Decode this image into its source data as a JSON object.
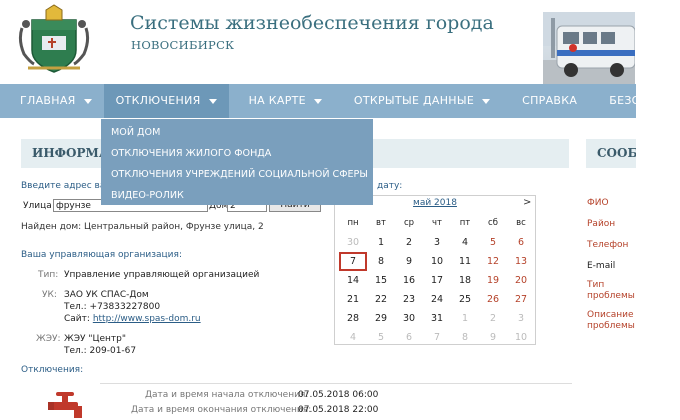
{
  "header": {
    "title": "Системы жизнеобеспечения города",
    "subtitle": "НОВОСИБИРСК"
  },
  "nav": {
    "items": [
      {
        "label": "ГЛАВНАЯ",
        "has_dropdown": true
      },
      {
        "label": "ОТКЛЮЧЕНИЯ",
        "has_dropdown": true,
        "active": true
      },
      {
        "label": "НА КАРТЕ",
        "has_dropdown": true
      },
      {
        "label": "ОТКРЫТЫЕ ДАННЫЕ",
        "has_dropdown": true
      },
      {
        "label": "СПРАВКА",
        "has_dropdown": false
      },
      {
        "label": "БЕЗОПАСНОС",
        "has_dropdown": false
      }
    ],
    "dropdown": [
      "МОЙ ДОМ",
      "ОТКЛЮЧЕНИЯ ЖИЛОГО ФОНДА",
      "ОТКЛЮЧЕНИЯ УЧРЕЖДЕНИЙ СОЦИАЛЬНОЙ СФЕРЫ",
      "ВИДЕО-РОЛИК"
    ]
  },
  "main": {
    "section_title": "ИНФОРМА",
    "address_prompt": "Введите адрес ва",
    "date_prompt": "дату:",
    "street_label": "Улица",
    "street_value": "фрунзе",
    "house_label": "Дом",
    "house_value": "2",
    "search_button": "Найти",
    "found_house": "Найден дом: Центральный район, Фрунзе улица, 2",
    "mgmt_heading": "Ваша управляющая организация:",
    "type_label": "Тип:",
    "type_value": "Управление управляющей организацией",
    "uk_label": "УК:",
    "uk_name": "ЗАО УК СПАС-Дом",
    "uk_phone": "Тел.: +73833227800",
    "uk_site_label": "Сайт:",
    "uk_site": "http://www.spas-dom.ru",
    "zheu_label": "ЖЭУ:",
    "zheu_name": "ЖЭУ \"Центр\"",
    "zheu_phone": "Тел.: 209-01-67",
    "outages_heading": "Отключения:",
    "start_label": "Дата и время начала отключения:",
    "start_value": "07.05.2018  06:00",
    "end_label": "Дата и время окончания отключения:",
    "end_value": "07.05.2018  22:00"
  },
  "calendar": {
    "prev": "<",
    "next": ">",
    "month": "май 2018",
    "weekdays": [
      "пн",
      "вт",
      "ср",
      "чт",
      "пт",
      "сб",
      "вс"
    ],
    "selected": "7",
    "weeks": [
      [
        "30",
        "1",
        "2",
        "3",
        "4",
        "5",
        "6"
      ],
      [
        "7",
        "8",
        "9",
        "10",
        "11",
        "12",
        "13"
      ],
      [
        "14",
        "15",
        "16",
        "17",
        "18",
        "19",
        "20"
      ],
      [
        "21",
        "22",
        "23",
        "24",
        "25",
        "26",
        "27"
      ],
      [
        "28",
        "29",
        "30",
        "31",
        "1",
        "2",
        "3"
      ],
      [
        "4",
        "5",
        "6",
        "7",
        "8",
        "9",
        "10"
      ]
    ]
  },
  "sidebar": {
    "title": "СООБ",
    "fields": [
      "ФИО",
      "Район",
      "Телефон",
      "E-mail",
      "Тип проблемы",
      "Описание проблемы"
    ]
  },
  "colors": {
    "nav_bg": "#8bb0cc",
    "nav_active": "#6d98b8",
    "title_color": "#3a6f7f",
    "accent_red": "#b5422a"
  }
}
